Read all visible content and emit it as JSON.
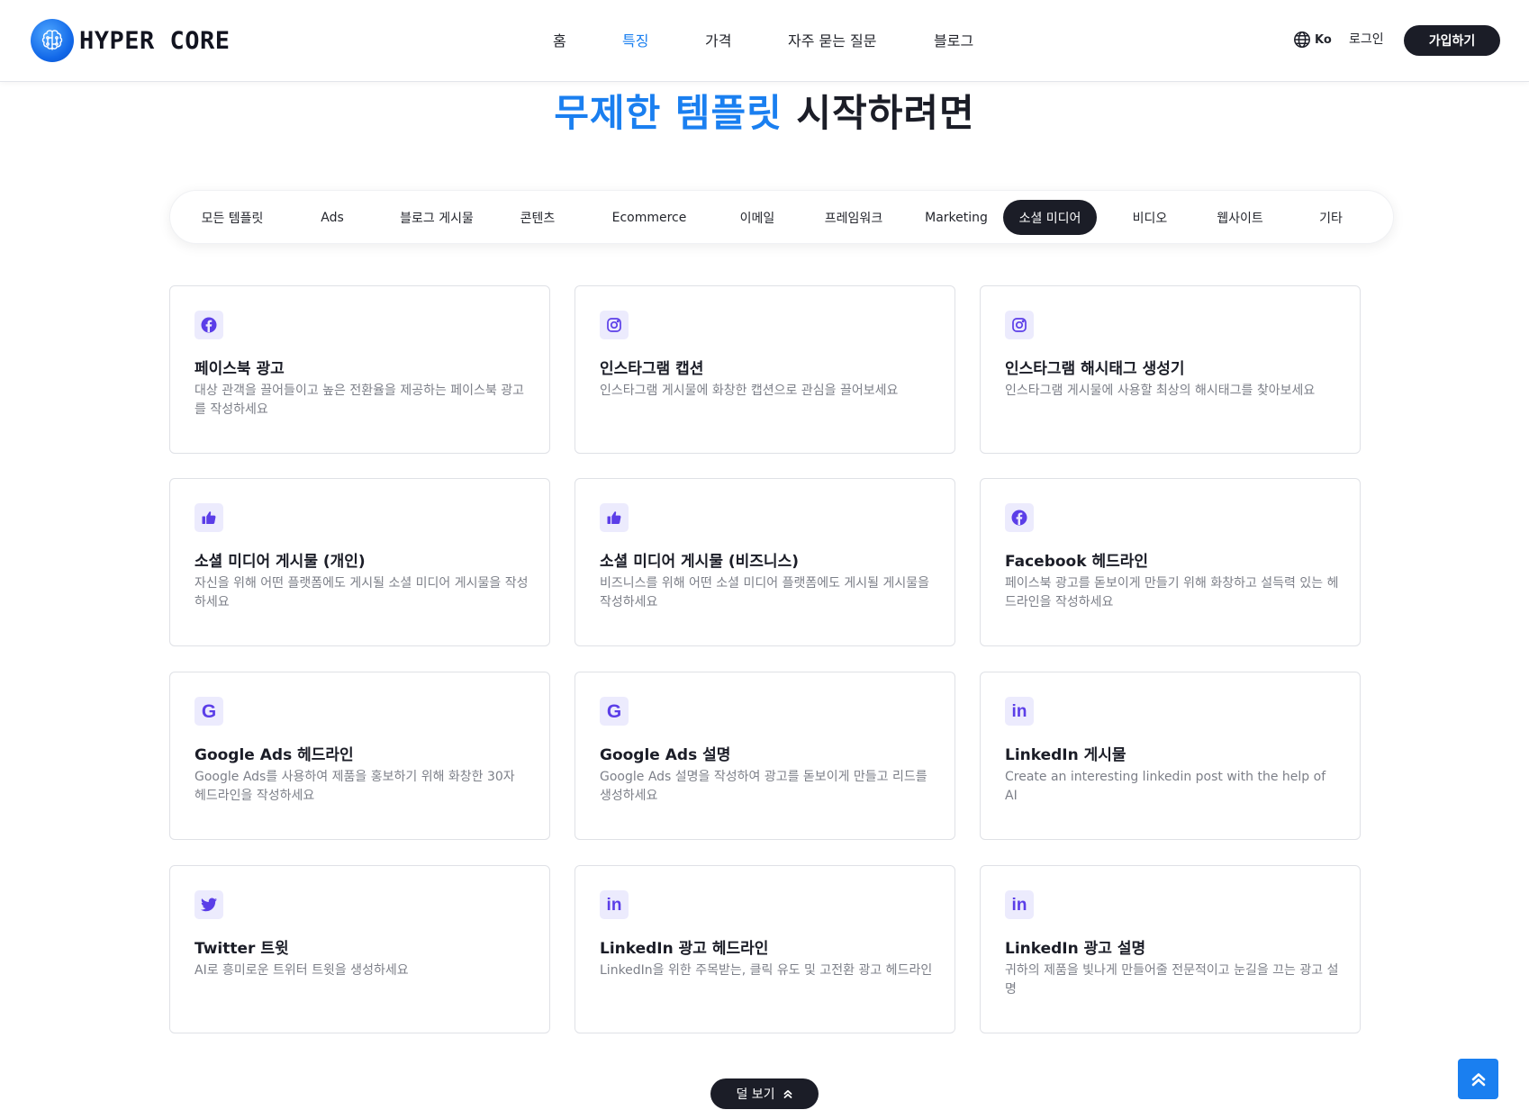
{
  "brand": {
    "name": "HYPER CORE"
  },
  "nav": {
    "items": [
      {
        "label": "홈",
        "active": false
      },
      {
        "label": "특징",
        "active": true
      },
      {
        "label": "가격",
        "active": false
      },
      {
        "label": "자주 묻는 질문",
        "active": false
      },
      {
        "label": "블로그",
        "active": false
      }
    ],
    "language": "Ko",
    "login": "로그인",
    "signup": "가입하기"
  },
  "title": {
    "highlight": "무제한 템플릿",
    "rest": " 시작하려면"
  },
  "tabs": [
    {
      "label": "모든 템플릿",
      "active": false
    },
    {
      "label": "Ads",
      "active": false
    },
    {
      "label": "블로그 게시물",
      "active": false
    },
    {
      "label": "콘텐츠",
      "active": false
    },
    {
      "label": "Ecommerce",
      "active": false
    },
    {
      "label": "이메일",
      "active": false
    },
    {
      "label": "프레임워크",
      "active": false
    },
    {
      "label": "Marketing",
      "active": false
    },
    {
      "label": "소셜 미디어",
      "active": true
    },
    {
      "label": "비디오",
      "active": false
    },
    {
      "label": "웹사이트",
      "active": false
    },
    {
      "label": "기타",
      "active": false
    }
  ],
  "cards": [
    {
      "icon": "facebook-icon",
      "title": "페이스북 광고",
      "description": "대상 관객을 끌어들이고 높은 전환율을 제공하는 페이스북 광고를 작성하세요"
    },
    {
      "icon": "instagram-icon",
      "title": "인스타그램 캡션",
      "description": "인스타그램 게시물에 화창한 캡션으로 관심을 끌어보세요"
    },
    {
      "icon": "instagram-icon",
      "title": "인스타그램 해시태그 생성기",
      "description": "인스타그램 게시물에 사용할 최상의 해시태그를 찾아보세요"
    },
    {
      "icon": "thumbs-up-icon",
      "title": "소셜 미디어 게시물 (개인)",
      "description": "자신을 위해 어떤 플랫폼에도 게시될 소셜 미디어 게시물을 작성하세요"
    },
    {
      "icon": "thumbs-up-icon",
      "title": "소셜 미디어 게시물 (비즈니스)",
      "description": "비즈니스를 위해 어떤 소셜 미디어 플랫폼에도 게시될 게시물을 작성하세요"
    },
    {
      "icon": "facebook-icon",
      "title": "Facebook 헤드라인",
      "description": "페이스북 광고를 돋보이게 만들기 위해 화창하고 설득력 있는 헤드라인을 작성하세요"
    },
    {
      "icon": "google-icon",
      "title": "Google Ads 헤드라인",
      "description": "Google Ads를 사용하여 제품을 홍보하기 위해 화창한 30자 헤드라인을 작성하세요"
    },
    {
      "icon": "google-icon",
      "title": "Google Ads 설명",
      "description": "Google Ads 설명을 작성하여 광고를 돋보이게 만들고 리드를 생성하세요"
    },
    {
      "icon": "linkedin-icon",
      "title": "LinkedIn 게시물",
      "description": "Create an interesting linkedin post with the help of AI"
    },
    {
      "icon": "twitter-icon",
      "title": "Twitter 트윗",
      "description": "AI로 흥미로운 트위터 트윗을 생성하세요"
    },
    {
      "icon": "linkedin-icon",
      "title": "LinkedIn 광고 헤드라인",
      "description": "LinkedIn을 위한 주목받는, 클릭 유도 및 고전환 광고 헤드라인"
    },
    {
      "icon": "linkedin-icon",
      "title": "LinkedIn 광고 설명",
      "description": "귀하의 제품을 빛나게 만들어줄 전문적이고 눈길을 끄는 광고 설명"
    }
  ],
  "less_button": "덜 보기",
  "colors": {
    "accent": "#1a7ff0",
    "dark": "#1b1d27",
    "icon": "#5b3ee8",
    "icon_bg": "#ecebfd"
  }
}
